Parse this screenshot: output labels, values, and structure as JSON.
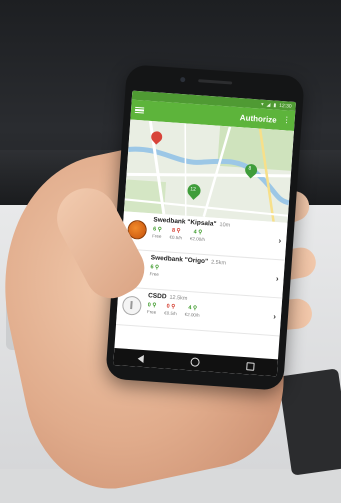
{
  "status_bar": {
    "time": "12:30"
  },
  "app_bar": {
    "action_label": "Authorize"
  },
  "map": {
    "markers": [
      {
        "label": "",
        "color": "#d8443a"
      },
      {
        "label": "8",
        "color": "#3f9d3a"
      },
      {
        "label": "12",
        "color": "#3f9d3a"
      }
    ]
  },
  "stations": [
    {
      "name": "Swedbank \"Kipsala\"",
      "distance": "10m",
      "stats": [
        {
          "value": "6",
          "caption": "Free",
          "tone": "green"
        },
        {
          "value": "8",
          "caption": "€0.5/h",
          "tone": "red"
        },
        {
          "value": "4",
          "caption": "€2.00/h",
          "tone": "green"
        }
      ]
    },
    {
      "name": "Swedbank \"Origo\"",
      "distance": "2.5km",
      "stats": [
        {
          "value": "6",
          "caption": "Free",
          "tone": "green"
        }
      ]
    },
    {
      "name": "CSDD",
      "distance": "12.5km",
      "stats": [
        {
          "value": "0",
          "caption": "Free",
          "tone": "green"
        },
        {
          "value": "0",
          "caption": "€0.5/h",
          "tone": "red"
        },
        {
          "value": "4",
          "caption": "€2.00/h",
          "tone": "green"
        }
      ]
    }
  ],
  "colors": {
    "primary": "#5db43b",
    "primary_dark": "#4f9a33",
    "free": "#3d9a2a",
    "paid": "#d33a2c"
  }
}
